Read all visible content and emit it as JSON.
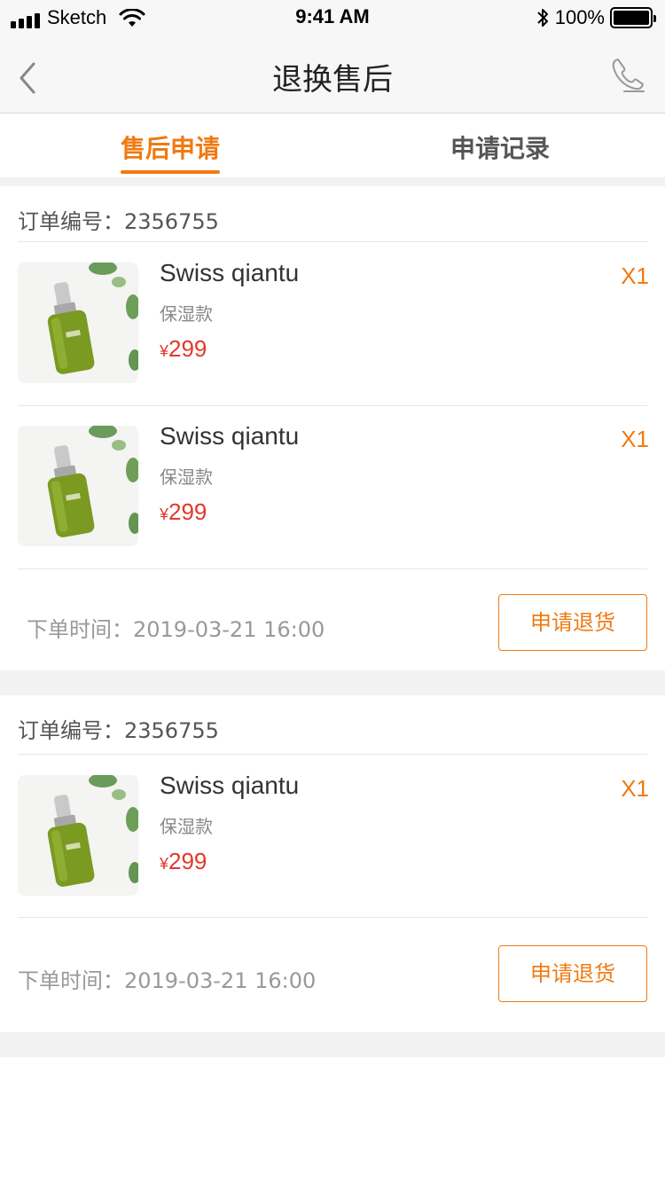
{
  "status_bar": {
    "carrier": "Sketch",
    "time": "9:41 AM",
    "battery": "100%"
  },
  "nav": {
    "title": "退换售后",
    "back_icon": "chevron-left-icon",
    "right_icon": "phone-icon"
  },
  "tabs": [
    {
      "label": "售后申请",
      "active": true
    },
    {
      "label": "申请记录",
      "active": false
    }
  ],
  "colors": {
    "accent": "#f07a12",
    "price": "#e0392b",
    "background_gap": "#f2f2f2"
  },
  "orders": [
    {
      "order_label": "订单编号：2356755",
      "items": [
        {
          "name": "Swiss qiantu",
          "variant": "保湿款",
          "currency": "¥",
          "price": "299",
          "qty": "X1"
        },
        {
          "name": "Swiss qiantu",
          "variant": "保湿款",
          "currency": "¥",
          "price": "299",
          "qty": "X1"
        }
      ],
      "time_label": "下单时间：2019-03-21 16:00",
      "action": "申请退货"
    },
    {
      "order_label": "订单编号：2356755",
      "items": [
        {
          "name": "Swiss qiantu",
          "variant": "保湿款",
          "currency": "¥",
          "price": "299",
          "qty": "X1"
        }
      ],
      "time_label": "下单时间：2019-03-21 16:00",
      "action": "申请退货"
    }
  ]
}
